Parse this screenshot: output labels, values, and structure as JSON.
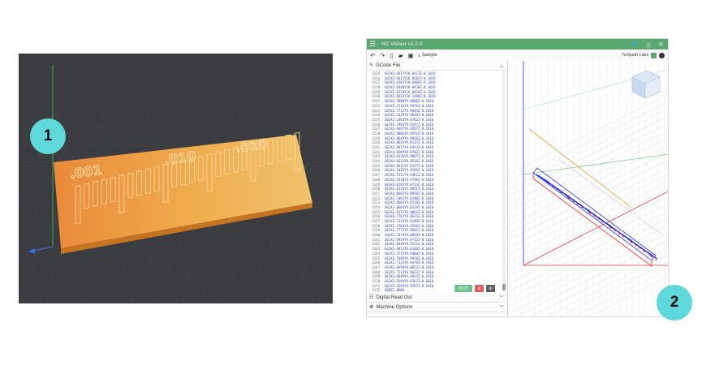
{
  "badges": {
    "left": "1",
    "right": "2"
  },
  "left_view": {
    "plate_labels": [
      ".001",
      ".010",
      ".020"
    ]
  },
  "app": {
    "title": "NC Viewer v1.2.0",
    "social_icons": [
      "twitter-icon",
      "facebook-icon",
      "instagram-icon"
    ],
    "toolbar": {
      "sample_label": "Sample",
      "brand": "Toolpath Labs",
      "icons": [
        "undo-icon",
        "redo-icon",
        "new-file-icon",
        "open-folder-icon",
        "save-icon",
        "download-icon"
      ]
    },
    "panels": {
      "gcode": "GCode File",
      "dro": "Digital Read Out",
      "machine": "Machine Options"
    },
    "buttons": {
      "plot": "PLOT",
      "stop": "⊘",
      "settings": "⚙"
    },
    "line_numbers": [
      "3125",
      "3126",
      "3127",
      "3128",
      "3129",
      "3130",
      "3131",
      "3132",
      "3133",
      "3134",
      "3135",
      "3136",
      "3137",
      "3138",
      "3139",
      "3140",
      "3141",
      "3142",
      "3143",
      "3144",
      "3145",
      "3146",
      "3147",
      "3148",
      "3149",
      "3150",
      "3151",
      "3152",
      "3153",
      "3154",
      "3155",
      "3156",
      "3157",
      "3158",
      "3159",
      "3160",
      "3161",
      "3162",
      "3163",
      "3164",
      "3165",
      "3166",
      "3167",
      "3168",
      "3169",
      "3170",
      "3171",
      "3172",
      "3173",
      "3174",
      "3175",
      "3176",
      "3177",
      "3178"
    ],
    "code_lines": [
      "G01X3.6617Y10.0313Z-0.1016",
      "G01X3.6613Y10.0382Z-0.1016",
      "G01X3.6381Y10.0408Z-0.1016",
      "G01X3.6448Y10.0436Z-0.1016",
      "G01X3.6259Y10.0458Z-0.1016",
      "G01X3.6613Y10.1308Z-0.1016",
      "G01X3.5880Y9.8800Z-0.1016",
      "G01X3.7234Y9.9476Z-0.1016",
      "G01X3.7712Y9.9844Z-0.1016",
      "G01X3.3329Y9.8818Z-0.1016",
      "G01X3.3364Y9.8782Z-0.1016",
      "G01X3.1994Y9.9247Z-0.1016",
      "G01X3.9497Y9.9267Z-0.1016",
      "G01X3.9066Y9.9476Z-0.1016",
      "G01X3.8649Y9.9836Z-0.1016",
      "G01X4.0624Y9.8137Z-0.1016",
      "G01X4.0677Y9.8913Z-0.1016",
      "G01X4.0289Y9.9782Z-0.1016",
      "G01X4.0339Y9.9807Z-0.1016",
      "G01X4.0333Y9.9516Z-0.1016",
      "G01X4.0431Y9.9417Z-0.1016",
      "G01X4.1026Y9.9599Z-0.1016",
      "G01X4.1511Y9.9362Z-0.1016",
      "G01X4.1838Y9.9799Z-0.1016",
      "G01X4.0293Y9.8713Z-0.1016",
      "G01X4.0133Y9.8851Z-0.1016",
      "G01X4.0665Y9.8850Z-0.1016",
      "G01X3.7661Y9.8180Z-0.1016",
      "G01X3.9663Y9.8118Z-0.1016",
      "G01X3.8604Y9.8129Z-0.1016",
      "G01X3.8177Y9.8862Z-0.1016",
      "G01X3.7762Y9.8633Z-0.1016",
      "G01X3.7315Y9.8189Z-0.1016",
      "G01X3.7204Y9.9556Z-0.1016",
      "G01X3.7772Y9.8682Z-0.1016",
      "G01X3.7079Y9.8856Z-0.1016",
      "G01X3.6959Y9.9733Z-0.1016",
      "G01X3.6949Y9.9372Z-0.1016",
      "G01X3.6913Y9.8148Z-0.1016",
      "G01X3.7272Y9.9488Z-0.1016",
      "G01X3.7689Y9.9978Z-0.1016",
      "G01X3.7133Y9.9478Z-0.1016",
      "G01X3.6959Y9.8812Z-0.1016",
      "G01X3.7513Y9.8622Z-0.1016",
      "G01X3.6649Y9.8813Z-0.1016",
      "G01X3.5594Y9.9267Z-0.1016",
      "G01X3.5599Y9.9267Z-0.1016",
      "G00Z2.0000",
      "G00X0.0000Y0.0000Z0.0000",
      "M05",
      "M30",
      "%",
      "",
      ""
    ]
  },
  "colors": {
    "topbar": "#5aa870",
    "plate": "#e8a54a",
    "toolpath": "#2233ee",
    "cut": "#ff2222",
    "badge": "#5fd8dc"
  }
}
